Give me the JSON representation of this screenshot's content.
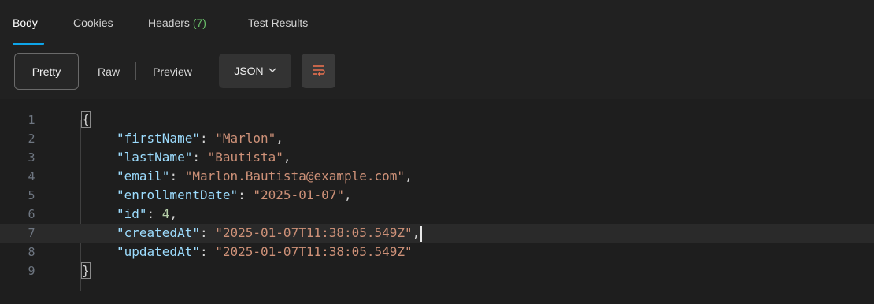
{
  "tabs": {
    "body": "Body",
    "cookies": "Cookies",
    "headers": "Headers",
    "headers_count": "(7)",
    "test_results": "Test Results"
  },
  "toolbar": {
    "pretty": "Pretty",
    "raw": "Raw",
    "preview": "Preview",
    "format": "JSON",
    "format_chevron": "⌄",
    "wrap_icon": "wrap-lines-icon"
  },
  "editor": {
    "line_numbers": [
      "1",
      "2",
      "3",
      "4",
      "5",
      "6",
      "7",
      "8",
      "9"
    ],
    "lines": [
      {
        "open": "{"
      },
      {
        "key": "\"firstName\"",
        "value": "\"Marlon\"",
        "type": "string",
        "comma": ","
      },
      {
        "key": "\"lastName\"",
        "value": "\"Bautista\"",
        "type": "string",
        "comma": ","
      },
      {
        "key": "\"email\"",
        "value": "\"Marlon.Bautista@example.com\"",
        "type": "string",
        "comma": ","
      },
      {
        "key": "\"enrollmentDate\"",
        "value": "\"2025-01-07\"",
        "type": "string",
        "comma": ","
      },
      {
        "key": "\"id\"",
        "value": "4",
        "type": "number",
        "comma": ","
      },
      {
        "key": "\"createdAt\"",
        "value": "\"2025-01-07T11:38:05.549Z\"",
        "type": "string",
        "comma": ","
      },
      {
        "key": "\"updatedAt\"",
        "value": "\"2025-01-07T11:38:05.549Z\"",
        "type": "string",
        "comma": ""
      },
      {
        "close": "}"
      }
    ]
  },
  "colors": {
    "background": "#1e1e1e",
    "accent": "#0ea5e9",
    "key": "#9cdcfe",
    "string": "#ce9178",
    "number": "#b5cea8",
    "wrap_icon": "#e8704f"
  }
}
